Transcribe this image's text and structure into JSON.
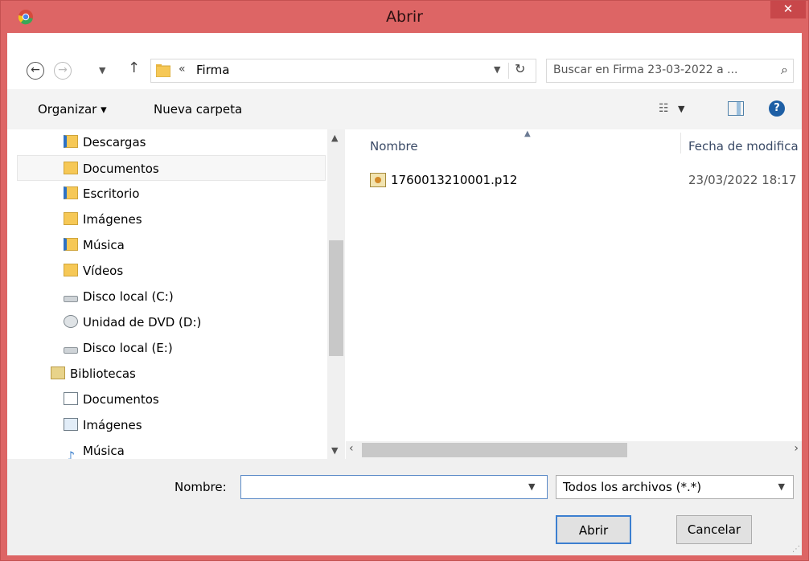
{
  "window": {
    "title": "Abrir",
    "close_label": "✕",
    "accent_color": "#dd6565"
  },
  "address": {
    "breadcrumb_prefix": "«",
    "current_folder": "Firma"
  },
  "search": {
    "placeholder": "Buscar en Firma 23-03-2022 a ..."
  },
  "toolbar": {
    "organize_label": "Organizar ▾",
    "new_folder_label": "Nueva carpeta"
  },
  "nav": {
    "items": [
      {
        "label": "Descargas",
        "icon": "downloads-folder-icon"
      },
      {
        "label": "Documentos",
        "icon": "documents-folder-icon"
      },
      {
        "label": "Escritorio",
        "icon": "desktop-folder-icon"
      },
      {
        "label": "Imágenes",
        "icon": "pictures-folder-icon"
      },
      {
        "label": "Música",
        "icon": "music-folder-icon"
      },
      {
        "label": "Vídeos",
        "icon": "videos-folder-icon"
      },
      {
        "label": "Disco local (C:)",
        "icon": "drive-c-icon"
      },
      {
        "label": "Unidad de DVD (D:)",
        "icon": "dvd-drive-icon"
      },
      {
        "label": "Disco local (E:)",
        "icon": "drive-e-icon"
      },
      {
        "label": "Bibliotecas",
        "icon": "libraries-icon"
      },
      {
        "label": "Documentos",
        "icon": "library-documents-icon"
      },
      {
        "label": "Imágenes",
        "icon": "library-pictures-icon"
      },
      {
        "label": "Música",
        "icon": "library-music-icon"
      }
    ],
    "selected_index": 1
  },
  "files": {
    "columns": {
      "name": "Nombre",
      "date": "Fecha de modifica"
    },
    "rows": [
      {
        "name": "1760013210001.p12",
        "date": "23/03/2022 18:17"
      }
    ]
  },
  "bottom": {
    "name_label": "Nombre:",
    "name_value": "",
    "file_type": "Todos los archivos (*.*)",
    "open_label": "Abrir",
    "cancel_label": "Cancelar"
  }
}
